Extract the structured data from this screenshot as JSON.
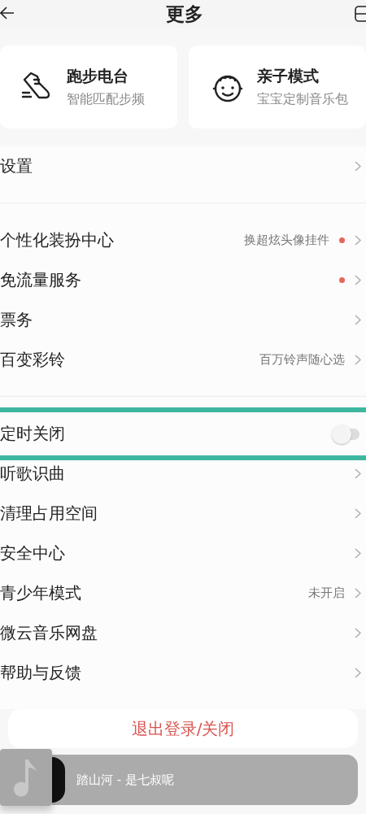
{
  "header": {
    "title": "更多"
  },
  "cards": [
    {
      "kind": "running",
      "title": "跑步电台",
      "subtitle": "智能匹配步频"
    },
    {
      "kind": "kids",
      "title": "亲子模式",
      "subtitle": "宝宝定制音乐包"
    }
  ],
  "sections": [
    {
      "rows": [
        {
          "kind": "link",
          "label": "设置",
          "highlighted": false
        }
      ]
    },
    {
      "rows": [
        {
          "kind": "link",
          "label": "个性化装扮中心",
          "value": "换超炫头像挂件",
          "badge_dot": true,
          "highlighted": false
        },
        {
          "kind": "link",
          "label": "免流量服务",
          "badge_dot": true,
          "highlighted": false
        },
        {
          "kind": "link",
          "label": "票务",
          "highlighted": false
        },
        {
          "kind": "link",
          "label": "百变彩铃",
          "value": "百万铃声随心选",
          "highlighted": false
        }
      ]
    },
    {
      "rows": [
        {
          "kind": "toggle",
          "label": "定时关闭",
          "on": false,
          "highlighted": true
        },
        {
          "kind": "link",
          "label": "听歌识曲",
          "highlighted": false
        },
        {
          "kind": "link",
          "label": "清理占用空间",
          "highlighted": false
        },
        {
          "kind": "link",
          "label": "安全中心",
          "highlighted": false
        },
        {
          "kind": "link",
          "label": "青少年模式",
          "value": "未开启",
          "highlighted": false
        },
        {
          "kind": "link",
          "label": "微云音乐网盘",
          "highlighted": false
        },
        {
          "kind": "link",
          "label": "帮助与反馈",
          "highlighted": false
        }
      ]
    }
  ],
  "logout_button": {
    "label": "退出登录/关闭"
  },
  "player": {
    "track": "踏山河 - 是七叔呢"
  }
}
